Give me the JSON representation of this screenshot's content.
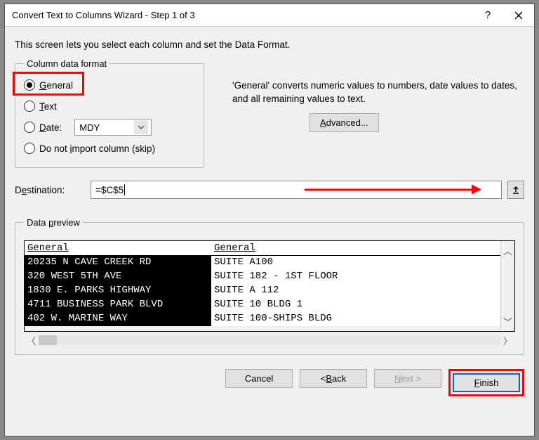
{
  "title": "Convert Text to Columns Wizard - Step 1 of 3",
  "subtitle": "This screen lets you select each column and set the Data Format.",
  "column_format": {
    "legend": "Column data format",
    "general": "General",
    "text": "Text",
    "date": "Date:",
    "date_value": "MDY",
    "skip": "Do not import column (skip)"
  },
  "description": "'General' converts numeric values to numbers, date values to dates, and all remaining values to text.",
  "advanced": "Advanced...",
  "destination": {
    "label": "Destination:",
    "value": "=$C$5"
  },
  "preview": {
    "legend": "Data preview",
    "col1_header": "General",
    "col2_header": "General",
    "col1": [
      "20235 N CAVE CREEK RD",
      "320 WEST 5TH AVE",
      "1830 E. PARKS HIGHWAY",
      "4711 BUSINESS PARK BLVD",
      "402 W. MARINE WAY"
    ],
    "col2": [
      "SUITE A100",
      "SUITE 182 - 1ST FLOOR",
      "SUITE A 112",
      "SUITE 10 BLDG 1",
      "SUITE 100-SHIPS BLDG"
    ]
  },
  "buttons": {
    "cancel": "Cancel",
    "back": "< Back",
    "next": "Next >",
    "finish": "Finish"
  }
}
